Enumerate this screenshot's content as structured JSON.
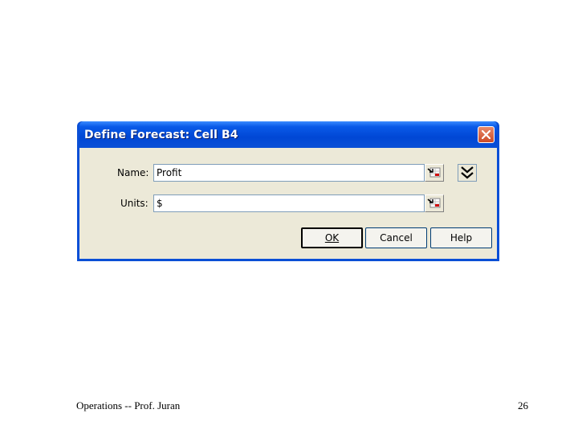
{
  "dialog": {
    "title": "Define Forecast: Cell B4",
    "name_label": "Name:",
    "name_value": "Profit",
    "units_label": "Units:",
    "units_value": "$",
    "buttons": {
      "ok": "OK",
      "cancel": "Cancel",
      "help": "Help"
    }
  },
  "footer": {
    "left": "Operations -- Prof. Juran",
    "page_number": "26"
  },
  "colors": {
    "titlebar": "#0a4fd6",
    "client_background": "#ece9d8",
    "close_button": "#cc4a26",
    "field_border": "#7f9db9"
  },
  "icons": [
    "close-icon",
    "cell-reference-picker-icon",
    "expand-chevron-icon"
  ]
}
